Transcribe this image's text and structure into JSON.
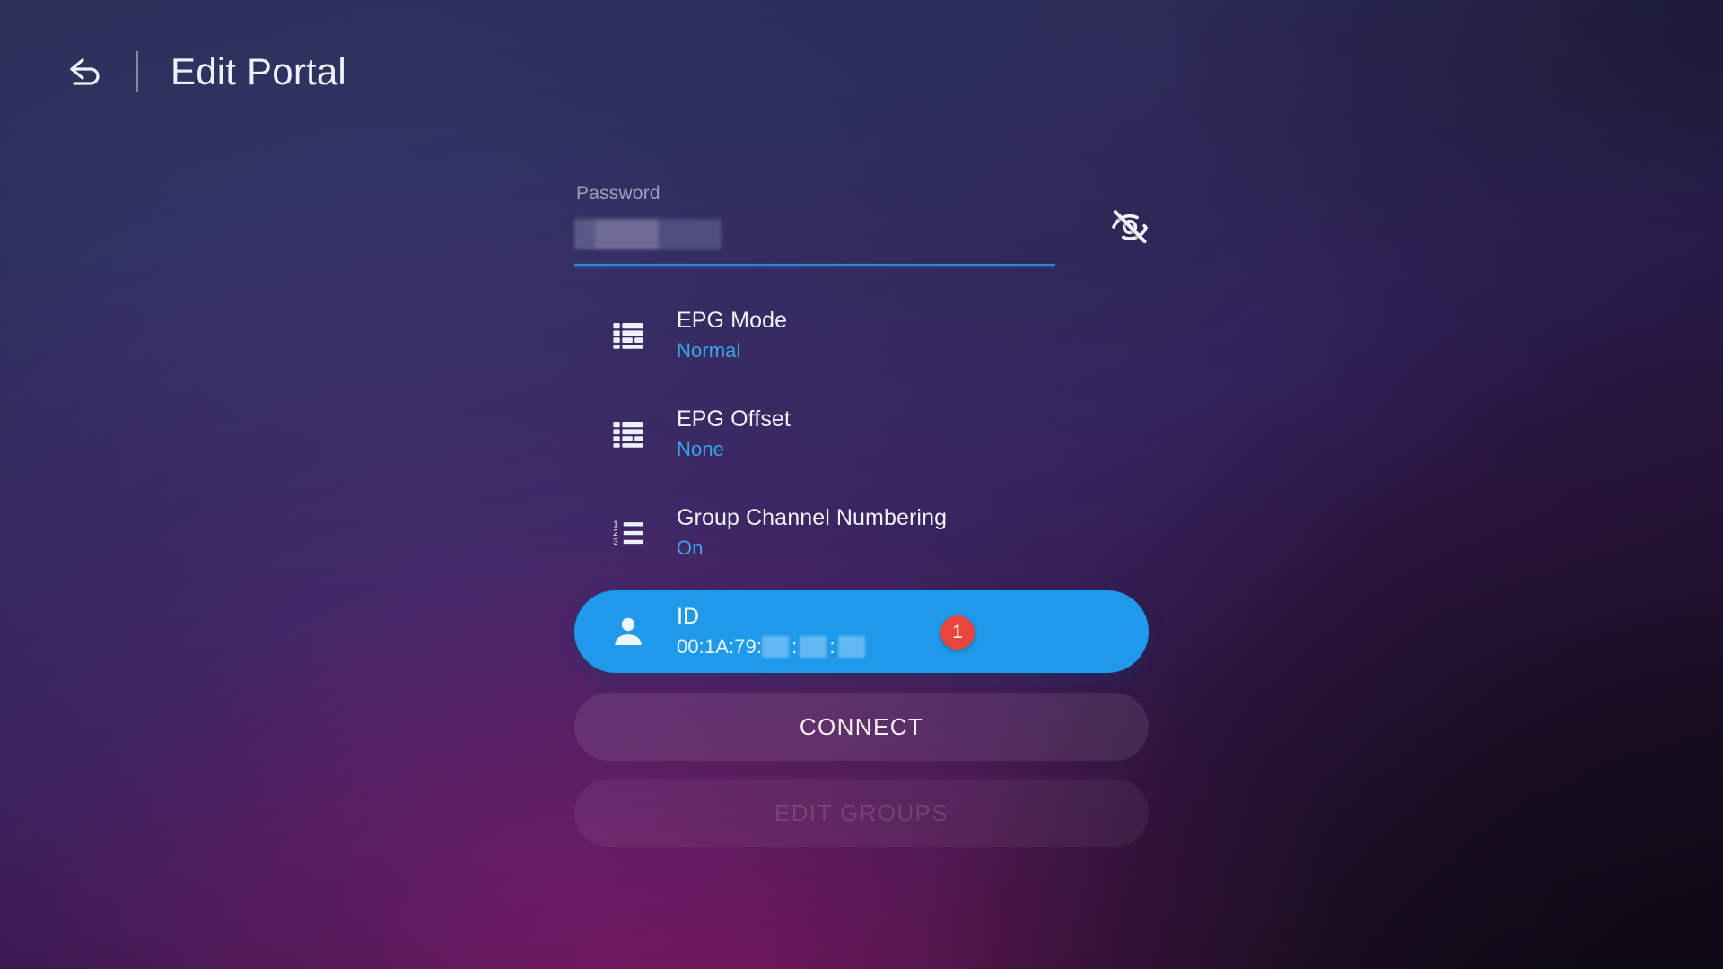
{
  "header": {
    "back_icon": "back-arrow-icon",
    "title": "Edit Portal"
  },
  "password": {
    "label": "Password",
    "value": "",
    "placeholder": "",
    "masked": true,
    "toggle_icon": "eye-off-icon"
  },
  "settings": [
    {
      "icon": "epg-grid-icon",
      "title": "EPG Mode",
      "value": "Normal",
      "selected": false,
      "badge": ""
    },
    {
      "icon": "epg-grid-icon",
      "title": "EPG Offset",
      "value": "None",
      "selected": false,
      "badge": ""
    },
    {
      "icon": "numbered-list-icon",
      "title": "Group Channel Numbering",
      "value": "On",
      "selected": false,
      "badge": ""
    },
    {
      "icon": "person-icon",
      "title": "ID",
      "value": "00:1A:79:",
      "selected": true,
      "badge": "1"
    }
  ],
  "actions": {
    "connect_label": "CONNECT",
    "edit_groups_label": "EDIT GROUPS",
    "edit_groups_disabled": true
  },
  "colors": {
    "accent_blue": "#1f9aeb",
    "value_blue": "#3aa3ea",
    "underline_blue": "#2e8ad6",
    "badge_red": "#e8453c",
    "text_primary": "#f0f2fa",
    "text_muted": "#9aa0bb"
  }
}
